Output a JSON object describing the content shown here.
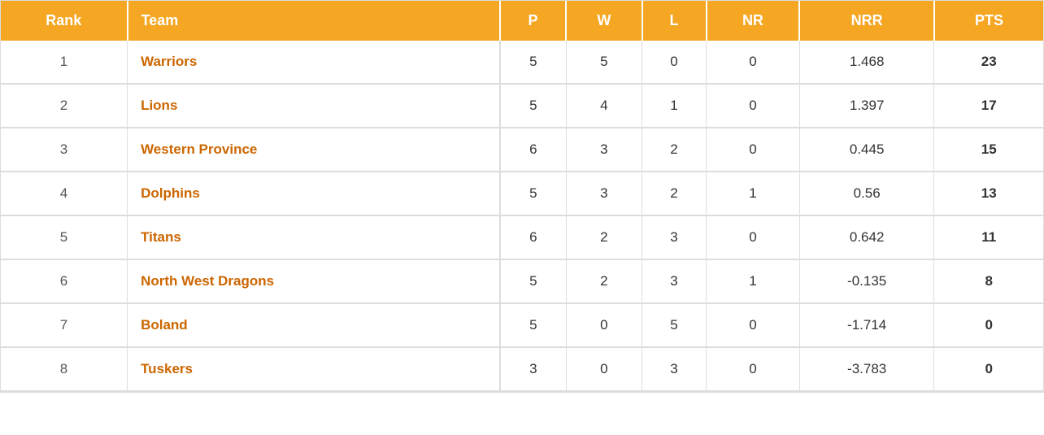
{
  "table": {
    "headers": [
      {
        "label": "Rank",
        "key": "rank"
      },
      {
        "label": "Team",
        "key": "team"
      },
      {
        "label": "P",
        "key": "p"
      },
      {
        "label": "W",
        "key": "w"
      },
      {
        "label": "L",
        "key": "l"
      },
      {
        "label": "NR",
        "key": "nr"
      },
      {
        "label": "NRR",
        "key": "nrr"
      },
      {
        "label": "PTS",
        "key": "pts"
      }
    ],
    "rows": [
      {
        "rank": "1",
        "team": "Warriors",
        "p": "5",
        "w": "5",
        "l": "0",
        "nr": "0",
        "nrr": "1.468",
        "pts": "23"
      },
      {
        "rank": "2",
        "team": "Lions",
        "p": "5",
        "w": "4",
        "l": "1",
        "nr": "0",
        "nrr": "1.397",
        "pts": "17"
      },
      {
        "rank": "3",
        "team": "Western Province",
        "p": "6",
        "w": "3",
        "l": "2",
        "nr": "0",
        "nrr": "0.445",
        "pts": "15"
      },
      {
        "rank": "4",
        "team": "Dolphins",
        "p": "5",
        "w": "3",
        "l": "2",
        "nr": "1",
        "nrr": "0.56",
        "pts": "13"
      },
      {
        "rank": "5",
        "team": "Titans",
        "p": "6",
        "w": "2",
        "l": "3",
        "nr": "0",
        "nrr": "0.642",
        "pts": "11"
      },
      {
        "rank": "6",
        "team": "North West Dragons",
        "p": "5",
        "w": "2",
        "l": "3",
        "nr": "1",
        "nrr": "-0.135",
        "pts": "8"
      },
      {
        "rank": "7",
        "team": "Boland",
        "p": "5",
        "w": "0",
        "l": "5",
        "nr": "0",
        "nrr": "-1.714",
        "pts": "0"
      },
      {
        "rank": "8",
        "team": "Tuskers",
        "p": "3",
        "w": "0",
        "l": "3",
        "nr": "0",
        "nrr": "-3.783",
        "pts": "0"
      }
    ]
  }
}
